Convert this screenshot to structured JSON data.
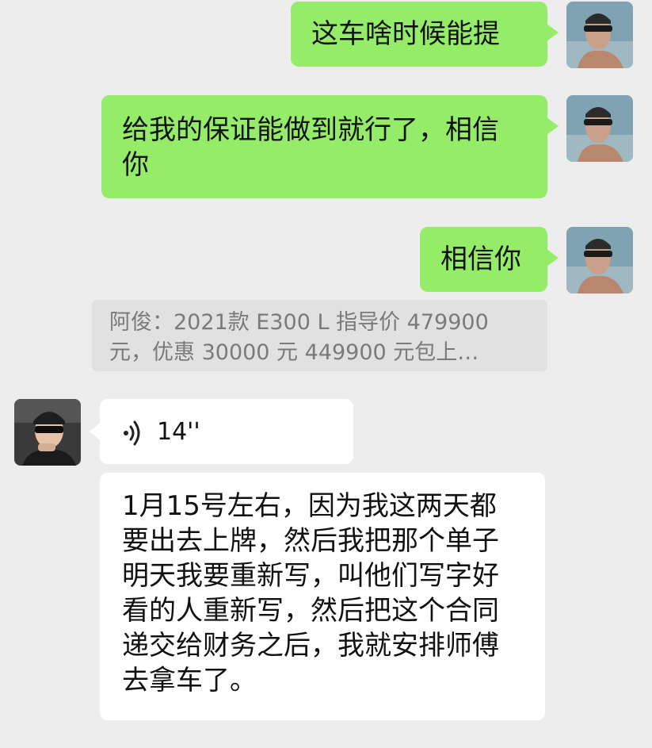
{
  "messages": [
    {
      "sender": "me",
      "type": "text",
      "lines": [
        "这车啥时候能提"
      ]
    },
    {
      "sender": "me",
      "type": "text",
      "lines": [
        "给我的保证能做到就行了，相信",
        "你"
      ]
    },
    {
      "sender": "me",
      "type": "text",
      "lines": [
        "相信你"
      ]
    },
    {
      "sender": "me",
      "type": "quote",
      "lines": [
        "阿俊：2021款 E300 L  指导价 479900",
        "元，优惠 30000 元 449900 元包上…"
      ]
    },
    {
      "sender": "other",
      "type": "voice",
      "duration": "14''"
    },
    {
      "sender": "other",
      "type": "text",
      "lines": [
        "1月15号左右，因为我这两天都",
        "要出去上牌，然后我把那个单子",
        "明天我要重新写，叫他们写字好",
        "看的人重新写，然后把这个合同",
        "递交给财务之后，我就安排师傅",
        "去拿车了。"
      ]
    }
  ],
  "colors": {
    "background": "#ededed",
    "my_bubble": "#95ec69",
    "other_bubble": "#ffffff",
    "quote_bg": "#e1e1e1"
  },
  "icons": [
    "my-avatar",
    "contact-avatar",
    "voice-wave-icon"
  ]
}
